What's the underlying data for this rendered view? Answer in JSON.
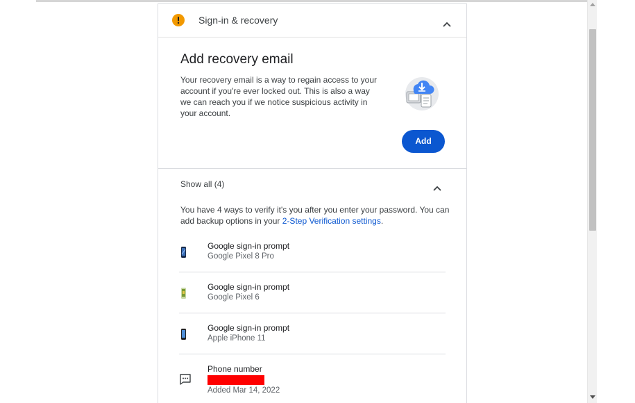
{
  "header": {
    "title": "Sign-in & recovery",
    "warning_icon": "warning-icon",
    "accent": "#f29900"
  },
  "recovery": {
    "title": "Add recovery email",
    "description": "Your recovery email is a way to regain access to your account if you're ever locked out. This is also a way we can reach you if we notice suspicious activity in your account.",
    "illustration": "cloud-download-illustration",
    "add_label": "Add",
    "button_color": "#0b57d0"
  },
  "verification": {
    "show_all_label": "Show all (4)",
    "description_prefix": "You have 4 ways to verify it's you after you enter your password. You can add backup options in your ",
    "link_text": "2-Step Verification settings",
    "description_suffix": ".",
    "link_color": "#0b57d0",
    "methods": [
      {
        "title": "Google sign-in prompt",
        "subtitle": "Google Pixel 8 Pro",
        "icon": "phone-icon"
      },
      {
        "title": "Google sign-in prompt",
        "subtitle": "Google Pixel 6",
        "icon": "phone-icon"
      },
      {
        "title": "Google sign-in prompt",
        "subtitle": "Apple iPhone 11",
        "icon": "phone-icon"
      },
      {
        "title": "Phone number",
        "subtitle": "Added Mar 14, 2022",
        "icon": "sms-icon",
        "redacted_color": "#ff0000"
      }
    ]
  }
}
